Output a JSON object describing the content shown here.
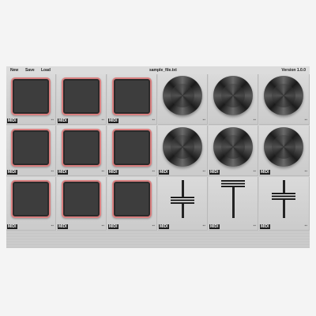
{
  "menu": {
    "new_label": "New",
    "save_label": "Save",
    "load_label": "Load",
    "file_name": "sample_file.txt",
    "version": "Version 1.0.0"
  },
  "cell_label": "MIDI",
  "cell_icon": "settings-dots-icon",
  "pads": [
    {
      "label": "MIDI"
    },
    {
      "label": "MIDI"
    },
    {
      "label": "MIDI"
    },
    {
      "label": "MIDI"
    },
    {
      "label": "MIDI"
    },
    {
      "label": "MIDI"
    },
    {
      "label": "MIDI"
    },
    {
      "label": "MIDI"
    },
    {
      "label": "MIDI"
    }
  ],
  "knobs": [
    {
      "label": ""
    },
    {
      "label": ""
    },
    {
      "label": ""
    },
    {
      "label": "MIDI"
    },
    {
      "label": "MIDI"
    },
    {
      "label": "MIDI"
    }
  ],
  "faders": [
    {
      "label": "MIDI",
      "value": 0.45
    },
    {
      "label": "MIDI",
      "value": 1.0
    },
    {
      "label": "MIDI",
      "value": 0.6
    }
  ],
  "colors": {
    "pad_outline": "#d98080",
    "pad_fill": "#3a3a3a",
    "panel": "#cfcfcf"
  }
}
